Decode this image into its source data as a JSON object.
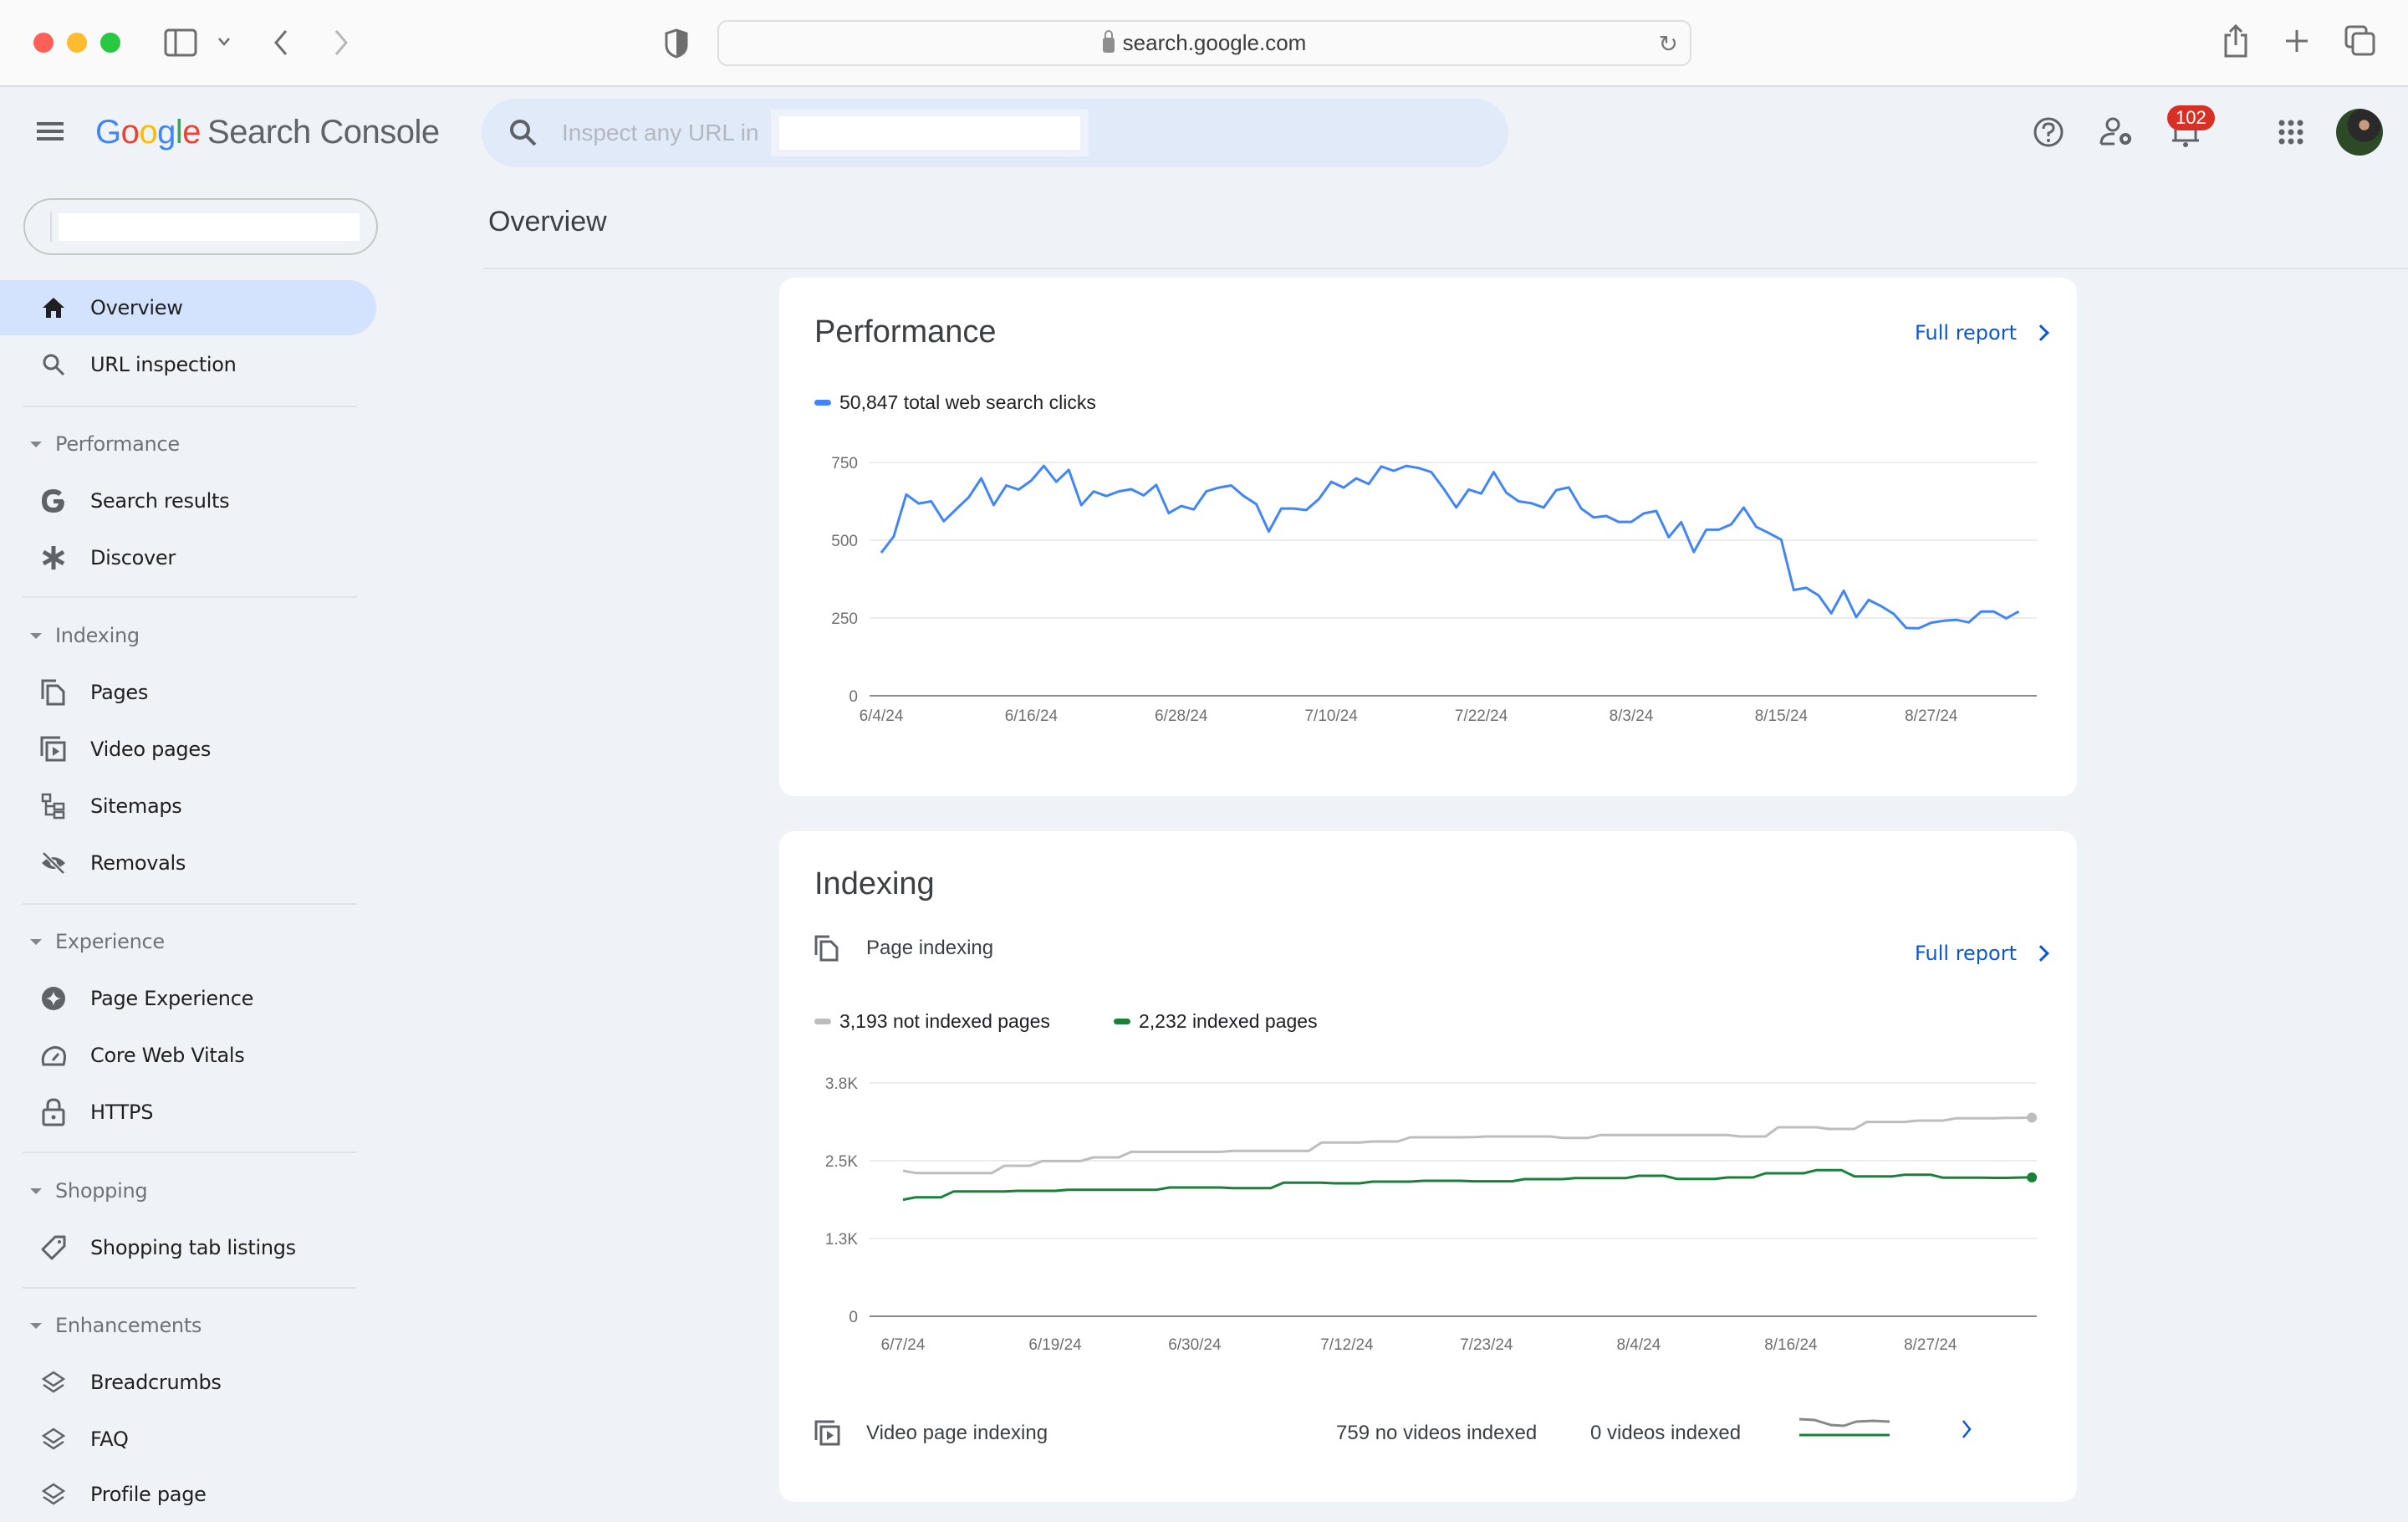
{
  "browser": {
    "url": "search.google.com",
    "icons": [
      "sidebar-toggle-icon",
      "chevron-down-icon",
      "back-icon",
      "forward-icon",
      "privacy-shield-icon",
      "lock-icon",
      "reload-icon",
      "share-icon",
      "new-tab-icon",
      "tabs-overview-icon"
    ]
  },
  "app": {
    "logo_letters": [
      "G",
      "o",
      "o",
      "g",
      "l",
      "e"
    ],
    "product_name": "Search Console",
    "search_placeholder": "Inspect any URL in",
    "notification_count": "102"
  },
  "sidebar": {
    "items": [
      {
        "label": "Overview",
        "icon": "home-icon",
        "active": true
      },
      {
        "label": "URL inspection",
        "icon": "search-icon"
      }
    ],
    "sections": [
      {
        "title": "Performance",
        "items": [
          {
            "label": "Search results",
            "icon": "google-g-icon"
          },
          {
            "label": "Discover",
            "icon": "asterisk-icon"
          }
        ]
      },
      {
        "title": "Indexing",
        "items": [
          {
            "label": "Pages",
            "icon": "pages-icon"
          },
          {
            "label": "Video pages",
            "icon": "video-pages-icon"
          },
          {
            "label": "Sitemaps",
            "icon": "sitemap-icon"
          },
          {
            "label": "Removals",
            "icon": "eye-off-icon"
          }
        ]
      },
      {
        "title": "Experience",
        "items": [
          {
            "label": "Page Experience",
            "icon": "page-experience-icon"
          },
          {
            "label": "Core Web Vitals",
            "icon": "gauge-icon"
          },
          {
            "label": "HTTPS",
            "icon": "lock-icon"
          }
        ]
      },
      {
        "title": "Shopping",
        "items": [
          {
            "label": "Shopping tab listings",
            "icon": "tag-icon"
          }
        ]
      },
      {
        "title": "Enhancements",
        "items": [
          {
            "label": "Breadcrumbs",
            "icon": "layers-icon"
          },
          {
            "label": "FAQ",
            "icon": "layers-icon"
          },
          {
            "label": "Profile page",
            "icon": "layers-icon"
          }
        ]
      }
    ]
  },
  "main": {
    "title": "Overview",
    "performance": {
      "title": "Performance",
      "full_report": "Full report",
      "legend": "50,847 total web search clicks",
      "color": "#4285f4"
    },
    "indexing": {
      "title": "Indexing",
      "page_indexing_label": "Page indexing",
      "full_report": "Full report",
      "legend_not_indexed": "3,193 not indexed pages",
      "legend_indexed": "2,232 indexed pages",
      "not_indexed_color": "#bdbdbd",
      "indexed_color": "#188038",
      "video": {
        "label": "Video page indexing",
        "no_videos": "759 no videos indexed",
        "videos": "0 videos indexed"
      }
    }
  },
  "chart_data": [
    {
      "type": "line",
      "title": "Performance",
      "ylabel": "Clicks",
      "ylim": [
        0,
        750
      ],
      "yticks": [
        "0",
        "250",
        "500",
        "750"
      ],
      "ytick_values": [
        0,
        250,
        500,
        750
      ],
      "x_start": "6/4/24",
      "x_step_days": 1,
      "xticks": [
        "6/4/24",
        "6/16/24",
        "6/28/24",
        "7/10/24",
        "7/22/24",
        "8/3/24",
        "8/15/24",
        "8/27/24"
      ],
      "xtick_index": [
        0,
        12,
        24,
        36,
        48,
        60,
        72,
        84
      ],
      "grid": true,
      "series": [
        {
          "name": "Clicks",
          "color": "#4285f4",
          "values": [
            460,
            512,
            647,
            618,
            625,
            561,
            600,
            638,
            699,
            613,
            676,
            663,
            692,
            739,
            688,
            726,
            613,
            657,
            642,
            657,
            664,
            644,
            678,
            587,
            610,
            599,
            657,
            669,
            676,
            642,
            616,
            528,
            602,
            602,
            597,
            632,
            688,
            669,
            699,
            681,
            737,
            723,
            739,
            732,
            719,
            665,
            605,
            663,
            650,
            719,
            653,
            625,
            619,
            605,
            661,
            670,
            602,
            573,
            578,
            559,
            559,
            586,
            594,
            510,
            558,
            462,
            534,
            534,
            551,
            605,
            543,
            523,
            502,
            340,
            347,
            322,
            265,
            338,
            253,
            308,
            288,
            263,
            218,
            217,
            235,
            241,
            244,
            236,
            271,
            271,
            249,
            271
          ]
        }
      ]
    },
    {
      "type": "line",
      "title": "Page indexing",
      "ylim": [
        0,
        3750
      ],
      "yticks": [
        "0",
        "1.3K",
        "2.5K",
        "3.8K"
      ],
      "ytick_values": [
        0,
        1250,
        2500,
        3750
      ],
      "x_start": "6/7/24",
      "x_step_days": 1,
      "xticks": [
        "6/7/24",
        "6/19/24",
        "6/30/24",
        "7/12/24",
        "7/23/24",
        "8/4/24",
        "8/16/24",
        "8/27/24"
      ],
      "xtick_index": [
        0,
        12,
        23,
        35,
        46,
        58,
        70,
        81
      ],
      "grid": true,
      "series": [
        {
          "name": "Not indexed",
          "color": "#bdbdbd",
          "values": [
            2339,
            2303,
            2303,
            2303,
            2303,
            2303,
            2303,
            2303,
            2419,
            2419,
            2419,
            2495,
            2495,
            2495,
            2495,
            2554,
            2554,
            2554,
            2643,
            2643,
            2643,
            2643,
            2643,
            2643,
            2643,
            2643,
            2657,
            2657,
            2657,
            2657,
            2657,
            2657,
            2657,
            2791,
            2791,
            2791,
            2791,
            2809,
            2809,
            2809,
            2876,
            2876,
            2876,
            2876,
            2876,
            2880,
            2890,
            2890,
            2890,
            2890,
            2890,
            2890,
            2867,
            2867,
            2867,
            2912,
            2912,
            2912,
            2912,
            2912,
            2912,
            2912,
            2912,
            2912,
            2912,
            2912,
            2890,
            2890,
            2890,
            3038,
            3038,
            3038,
            3038,
            3011,
            3011,
            3011,
            3123,
            3123,
            3123,
            3123,
            3145,
            3145,
            3145,
            3181,
            3181,
            3181,
            3181,
            3190,
            3190,
            3193
          ]
        },
        {
          "name": "Indexed",
          "color": "#188038",
          "values": [
            1873,
            1913,
            1913,
            1913,
            2007,
            2007,
            2007,
            2007,
            2007,
            2016,
            2016,
            2016,
            2016,
            2034,
            2034,
            2034,
            2034,
            2034,
            2034,
            2034,
            2034,
            2070,
            2070,
            2070,
            2070,
            2070,
            2061,
            2061,
            2061,
            2061,
            2146,
            2146,
            2146,
            2146,
            2137,
            2137,
            2137,
            2164,
            2164,
            2164,
            2164,
            2177,
            2177,
            2177,
            2177,
            2170,
            2170,
            2170,
            2170,
            2204,
            2204,
            2204,
            2204,
            2222,
            2222,
            2222,
            2222,
            2222,
            2258,
            2258,
            2258,
            2209,
            2209,
            2209,
            2209,
            2231,
            2231,
            2231,
            2298,
            2298,
            2298,
            2298,
            2348,
            2348,
            2348,
            2249,
            2249,
            2249,
            2249,
            2276,
            2276,
            2276,
            2227,
            2227,
            2227,
            2227,
            2225,
            2225,
            2230,
            2232
          ]
        }
      ]
    }
  ]
}
